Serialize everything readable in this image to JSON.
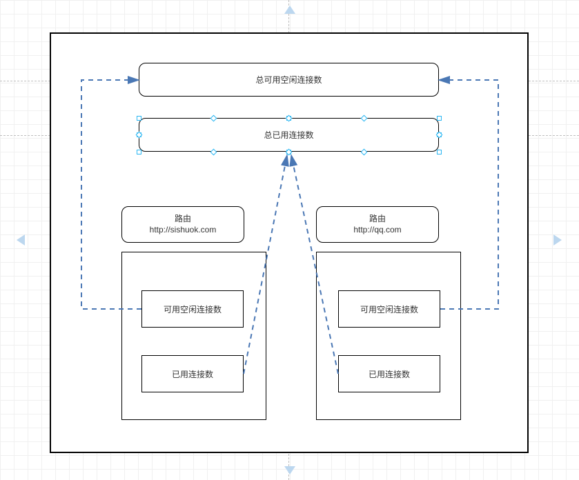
{
  "chart_data": {
    "type": "diagram",
    "title": "",
    "nodes": [
      {
        "id": "outer",
        "label": "",
        "shape": "rect"
      },
      {
        "id": "total_idle",
        "label": "总可用空闲连接数",
        "shape": "rounded-rect"
      },
      {
        "id": "total_used",
        "label": "总已用连接数",
        "shape": "rounded-rect",
        "selected": true
      },
      {
        "id": "route1",
        "label_line1": "路由",
        "label_line2": "http://sishuok.com",
        "shape": "rounded-rect"
      },
      {
        "id": "route2",
        "label_line1": "路由",
        "label_line2": "http://qq.com",
        "shape": "rounded-rect"
      },
      {
        "id": "pool1",
        "label": "",
        "shape": "rect"
      },
      {
        "id": "pool2",
        "label": "",
        "shape": "rect"
      },
      {
        "id": "idle1",
        "label": "可用空闲连接数",
        "shape": "rect"
      },
      {
        "id": "used1",
        "label": "已用连接数",
        "shape": "rect"
      },
      {
        "id": "idle2",
        "label": "可用空闲连接数",
        "shape": "rect"
      },
      {
        "id": "used2",
        "label": "已用连接数",
        "shape": "rect"
      }
    ],
    "edges": [
      {
        "from": "idle1",
        "to": "total_idle",
        "style": "dashed",
        "color": "#4a77b4"
      },
      {
        "from": "idle2",
        "to": "total_idle",
        "style": "dashed",
        "color": "#4a77b4"
      },
      {
        "from": "used1",
        "to": "total_used",
        "style": "dashed",
        "color": "#4a77b4"
      },
      {
        "from": "used2",
        "to": "total_used",
        "style": "dashed",
        "color": "#4a77b4"
      }
    ]
  },
  "labels": {
    "total_idle": "总可用空闲连接数",
    "total_used": "总已用连接数",
    "route1_line1": "路由",
    "route1_line2": "http://sishuok.com",
    "route2_line1": "路由",
    "route2_line2": "http://qq.com",
    "idle1": "可用空闲连接数",
    "used1": "已用连接数",
    "idle2": "可用空闲连接数",
    "used2": "已用连接数"
  },
  "colors": {
    "edge": "#4a77b4",
    "selection": "#29b6f2",
    "extension_arrow": "#bcd7ef",
    "guide": "#bdbdbd"
  }
}
